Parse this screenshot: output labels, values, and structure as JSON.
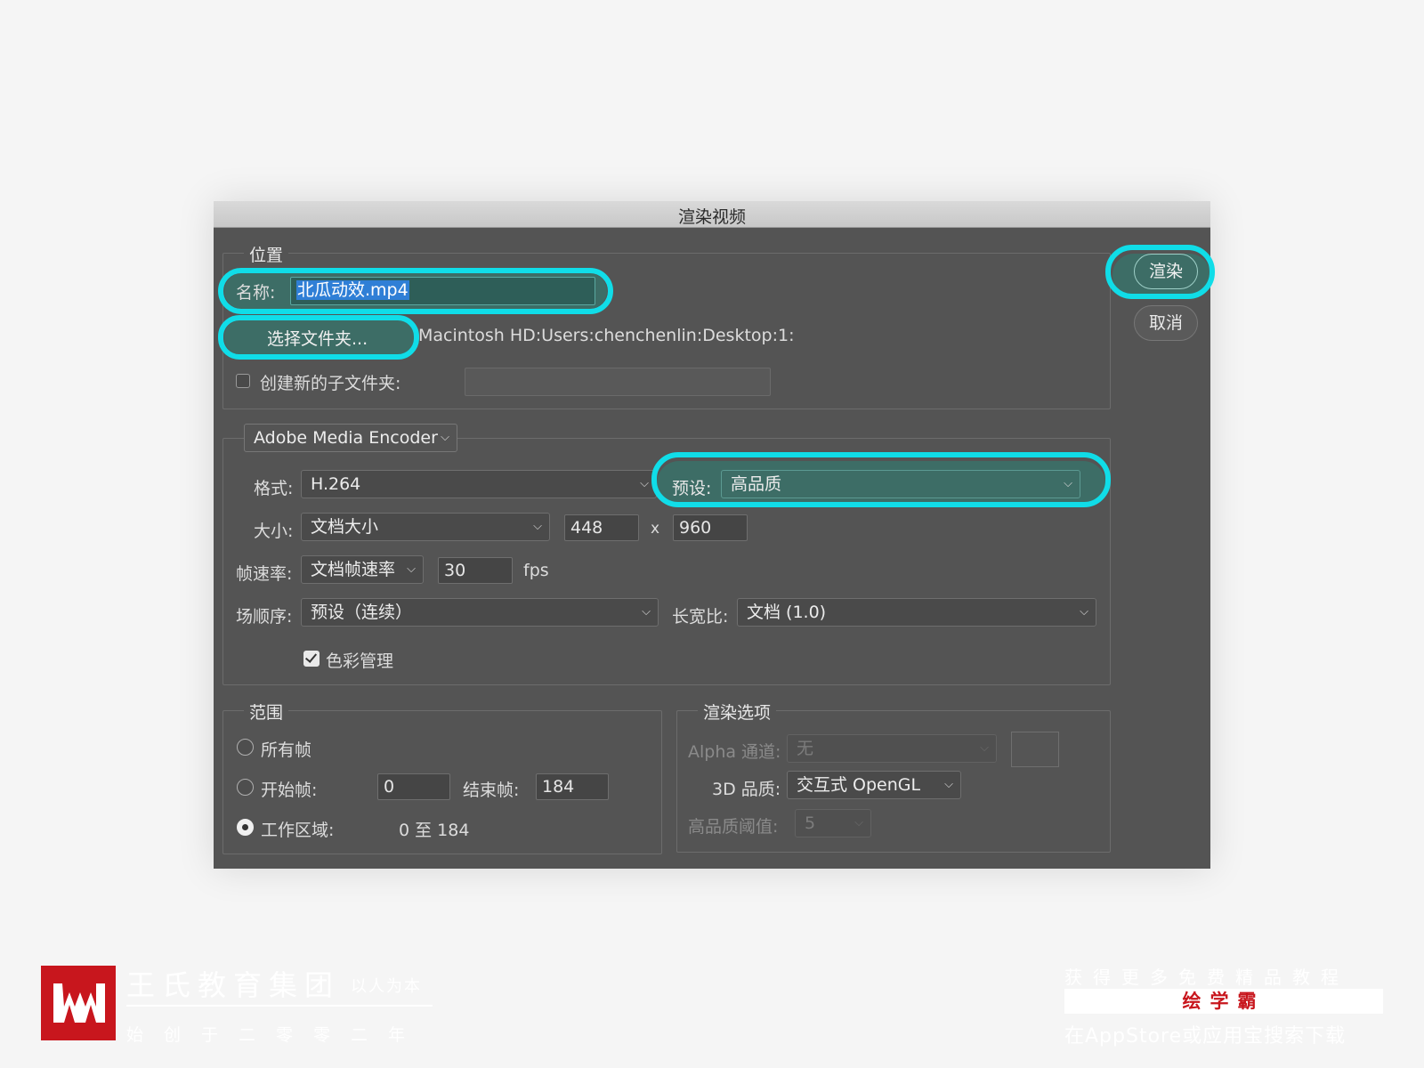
{
  "dialog": {
    "title": "渲染视频",
    "location": {
      "legend": "位置",
      "name_label": "名称:",
      "name_value": "北瓜动效.mp4",
      "choose_folder_button": "选择文件夹...",
      "folder_path": "Macintosh HD:Users:chenchenlin:Desktop:1:",
      "subfolder_checkbox_label": "创建新的子文件夹:",
      "subfolder_checked": false,
      "subfolder_value": ""
    },
    "render_button": "渲染",
    "cancel_button": "取消",
    "encoder": {
      "selected": "Adobe Media Encoder",
      "format_label": "格式:",
      "format_value": "H.264",
      "preset_label": "预设:",
      "preset_value": "高品质",
      "size_label": "大小:",
      "size_value": "文档大小",
      "width": "448",
      "x_sep": "x",
      "height": "960",
      "framerate_label": "帧速率:",
      "framerate_select": "文档帧速率",
      "framerate_value": "30",
      "fps_unit": "fps",
      "field_order_label": "场顺序:",
      "field_order_value": "预设（连续）",
      "aspect_label": "长宽比:",
      "aspect_value": "文档 (1.0)",
      "color_mgmt_label": "色彩管理",
      "color_mgmt_checked": true
    },
    "range": {
      "legend": "范围",
      "all_frames": "所有帧",
      "start_frame_label": "开始帧:",
      "start_frame_value": "0",
      "end_frame_label": "结束帧:",
      "end_frame_value": "184",
      "work_area_label": "工作区域:",
      "work_area_value": "0 至 184",
      "selected": "work_area"
    },
    "render_options": {
      "legend": "渲染选项",
      "alpha_label": "Alpha 通道:",
      "alpha_value": "无",
      "quality3d_label": "3D 品质:",
      "quality3d_value": "交互式 OpenGL",
      "hq_threshold_label": "高品质阈值:",
      "hq_threshold_value": "5"
    }
  },
  "watermark": {
    "company": "王氏教育集团",
    "slogan": "以人为本",
    "founded": "始创于二零零二年",
    "promo_line1": "获得更多免费精品教程",
    "promo_brand": "绘学霸",
    "promo_line2": "在AppStore或应用宝搜索下载"
  },
  "colors": {
    "highlight": "#10dde8",
    "teal_fill": "#3d6d66",
    "dialog_bg": "#545454",
    "logo_red": "#c8161d"
  }
}
